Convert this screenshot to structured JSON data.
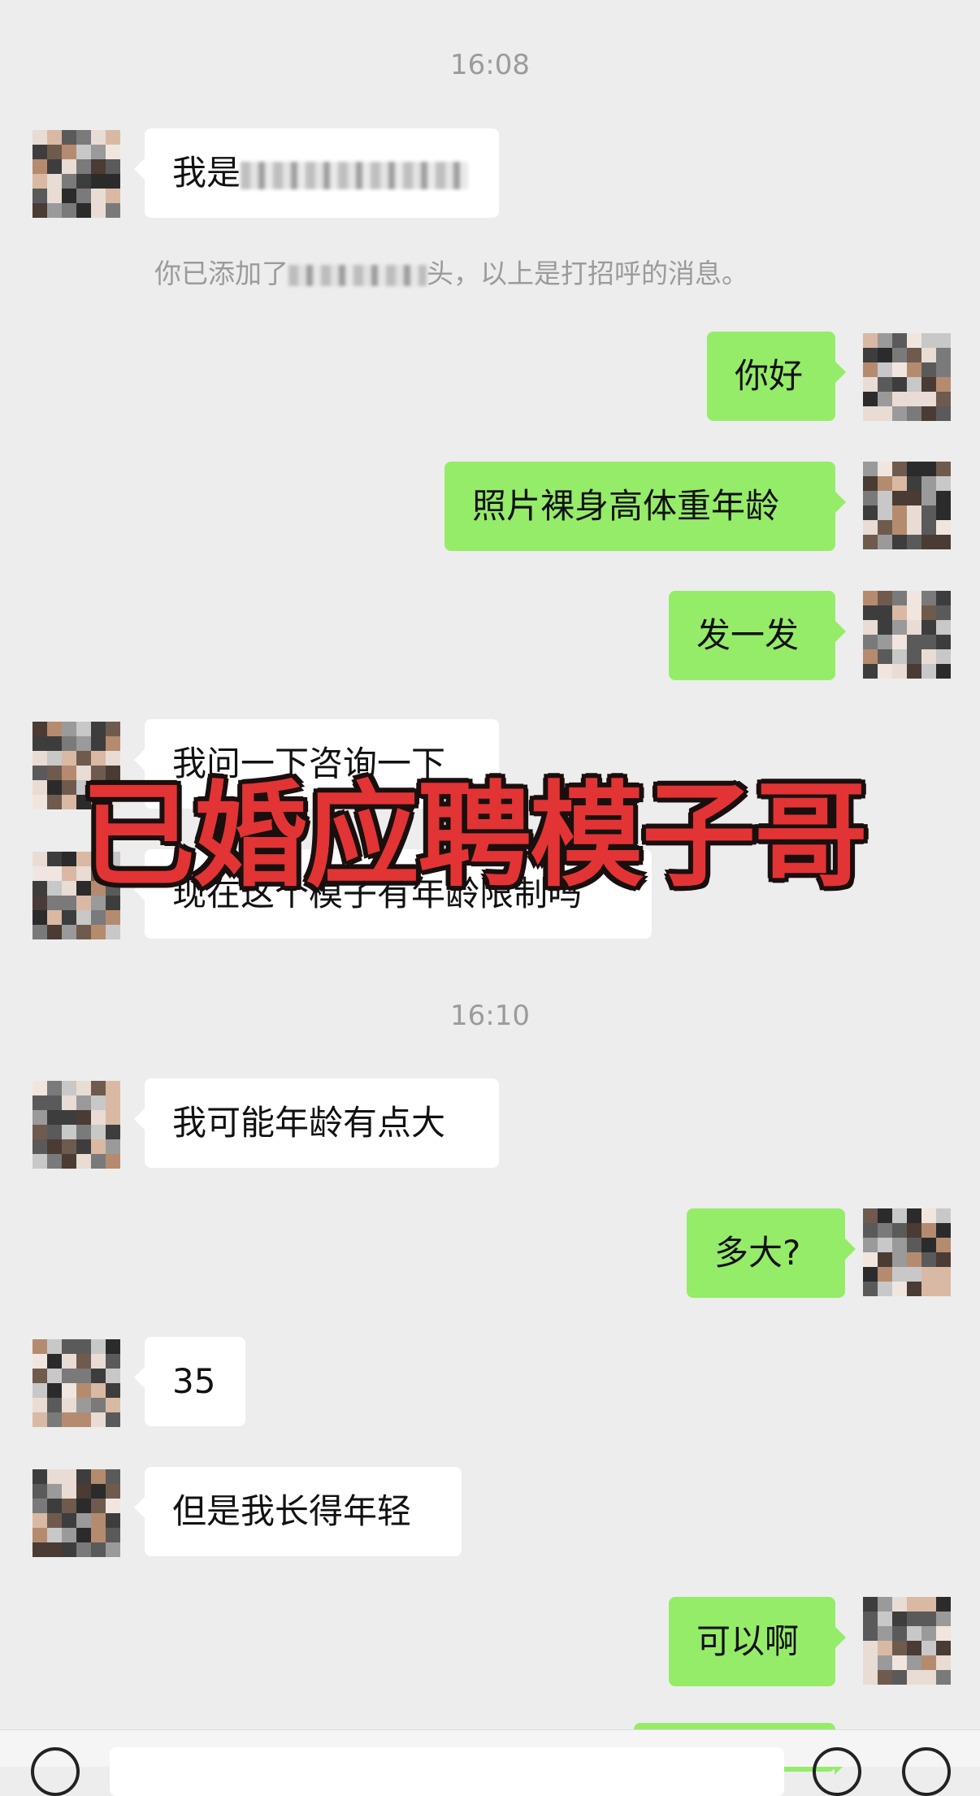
{
  "chat": {
    "time_1": "16:08",
    "msg_intro_prefix": "我是",
    "system_notice_prefix": "你已添加了",
    "system_notice_suffix": "头，以上是打招呼的消息。",
    "msg_hello": "你好",
    "msg_request_photos": "照片裸身高体重年龄",
    "msg_send": "发一发",
    "msg_ask": "我问一下咨询一下",
    "msg_age_limit": "现在这个模子有年龄限制吗",
    "time_2": "16:10",
    "msg_maybe_old": "我可能年龄有点大",
    "msg_how_old": "多大?",
    "msg_age": "35",
    "msg_look_young": "但是我长得年轻",
    "msg_ok": "可以啊"
  },
  "overlay": {
    "caption": "已婚应聘模子哥"
  },
  "colors": {
    "background": "#ededed",
    "outgoing_bubble": "#95ec69",
    "incoming_bubble": "#ffffff",
    "overlay_text": "#e23434"
  }
}
